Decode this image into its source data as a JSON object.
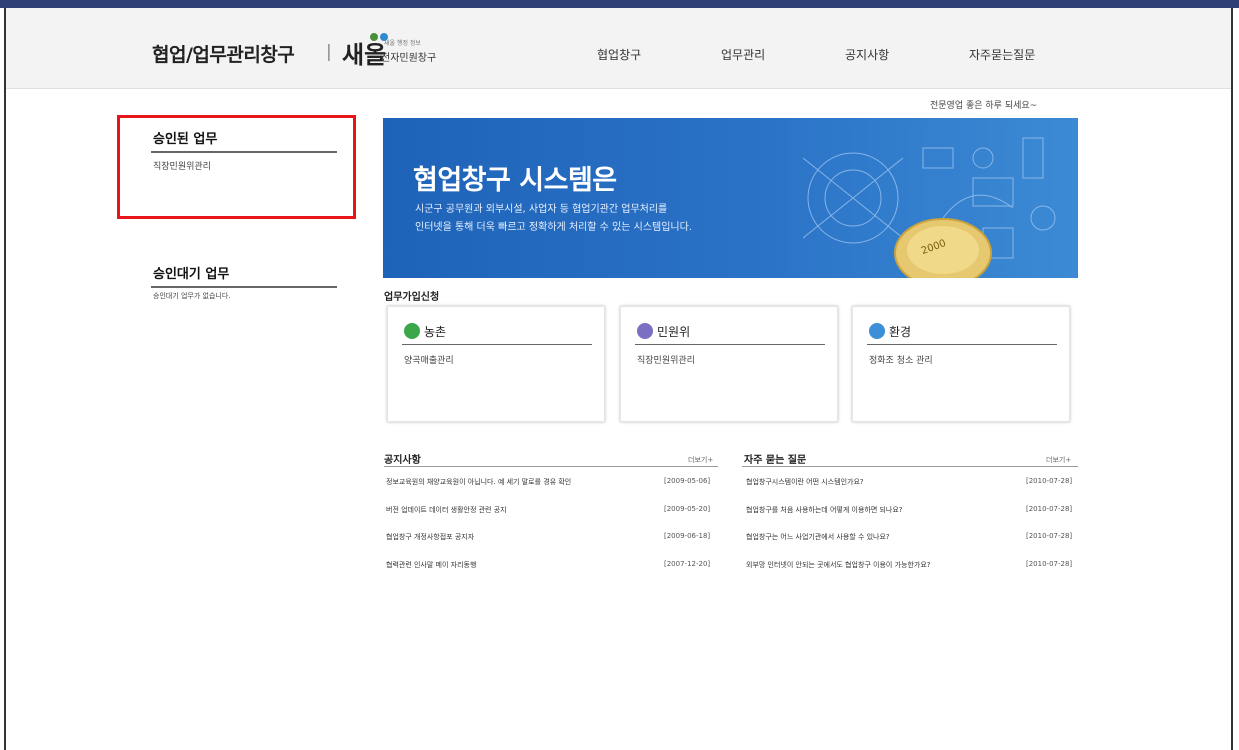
{
  "header": {
    "title": "협업/업무관리창구",
    "separator": "|",
    "brand": "새올",
    "brand_sub": "전자민원창구",
    "brand_tiny": "새올 행정 정보",
    "nav": [
      "협업창구",
      "업무관리",
      "공지사항",
      "자주묻는질문"
    ]
  },
  "note": "전문영업 좋은 하루 되세요~",
  "sidebar": {
    "approved_title": "승인된 업무",
    "approved_items": [
      "직장민원위관리"
    ],
    "pending_title": "승인대기 업무",
    "pending_empty": "승인대기 업무가 없습니다."
  },
  "banner": {
    "title": "협업창구 시스템은",
    "desc1": "시군구 공무원과 외부시설, 사업자 등 협업기관간 업무처리를",
    "desc2": "인터넷을 통해 더욱 빠르고 정확하게 처리할 수 있는 시스템입니다.",
    "coin_label": "2000"
  },
  "join_section": {
    "label": "업무가입신청",
    "cards": [
      {
        "title": "농촌",
        "item": "양곡매출관리",
        "icon_color": "#3aa84a"
      },
      {
        "title": "민원위",
        "item": "직장민원위관리",
        "icon_color": "#7b6fc4"
      },
      {
        "title": "환경",
        "item": "정화조 청소 관리",
        "icon_color": "#3b8fd6"
      }
    ]
  },
  "notices": {
    "title": "공지사항",
    "more": "더보기+",
    "rows": [
      {
        "text": "정보교육원의 채양교육원이 아닙니다. 예 세기 말로를 경유 확인",
        "date": "[2009-05-06]"
      },
      {
        "text": "버전 업데이트 데이터 생활안정 관련 공지",
        "date": "[2009-05-20]"
      },
      {
        "text": "협업창구 개정사항접포 공지자",
        "date": "[2009-06-18]"
      },
      {
        "text": "협력관련 인사말 메이 자리동행",
        "date": "[2007-12-20]"
      }
    ]
  },
  "faq": {
    "title": "자주 묻는 질문",
    "more": "더보기+",
    "rows": [
      {
        "text": "협업창구시스템이란 어떤 시스템인가요?",
        "date": "[2010-07-28]"
      },
      {
        "text": "협업창구를 처음 사용하는데 어떻게 이용하면 되나요?",
        "date": "[2010-07-28]"
      },
      {
        "text": "협업창구는 어느 사업기관에서 사용할 수 있나요?",
        "date": "[2010-07-28]"
      },
      {
        "text": "외부망 인터넷이 안되는 곳에서도 협업창구 이용이 가능한가요?",
        "date": "[2010-07-28]"
      }
    ]
  }
}
